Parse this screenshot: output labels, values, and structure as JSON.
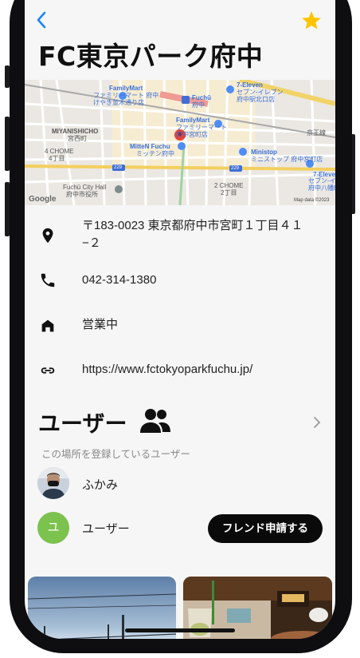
{
  "nav": {
    "back_icon": "chevron-left-icon",
    "favorite_icon": "star-icon",
    "accent": "#1a84ff",
    "star_color": "#ffc400"
  },
  "place": {
    "title": "FC東京パーク府中"
  },
  "map": {
    "labels": {
      "familymart1": "FamilyMart",
      "familymart1_sub": "ファミリーマート 府中\nけやき並木通り店",
      "fuchu": "Fuchū",
      "fuchu_sub": "府中",
      "seven1": "7-Eleven",
      "seven1_sub": "セブン-イレブン\n府中駅北口店",
      "familymart2": "FamilyMart",
      "familymart2_sub": "ファミリーマート\n府中宮町店",
      "miyanishicho": "MIYANISHICHO",
      "miyanishicho_jp": "宮西町",
      "keio": "京王線",
      "chome4": "4 CHOME",
      "chome4_jp": "4丁目",
      "mitten": "MitteN Fuchu",
      "mitten_sub": "ミッテン府中",
      "ministop": "Ministop",
      "ministop_sub": "ミニストップ 府中宮町店",
      "seven2": "7-Eleven",
      "seven2_sub": "セブン-イレブン\n府中八幡町",
      "road229a": "229",
      "road229b": "229",
      "cityhall": "Fuchū City Hall",
      "cityhall_sub": "府中市役所",
      "chome2": "2 CHOME",
      "chome2_jp": "2丁目",
      "google": "Google",
      "mapdata": "Map data ©2023"
    }
  },
  "info": {
    "address": "〒183-0023 東京都府中市宮町１丁目４１−２",
    "phone": "042-314-1380",
    "status": "営業中",
    "url": "https://www.fctokyoparkfuchu.jp/"
  },
  "users": {
    "title": "ユーザー",
    "subtitle": "この場所を登録しているユーザー",
    "list": [
      {
        "name": "ふかみ",
        "avatar": "photo-avatar"
      },
      {
        "name": "ユーザー",
        "initial": "ユ",
        "avatar_color": "#7cc24e"
      }
    ],
    "friend_button": "フレンド申請する"
  }
}
